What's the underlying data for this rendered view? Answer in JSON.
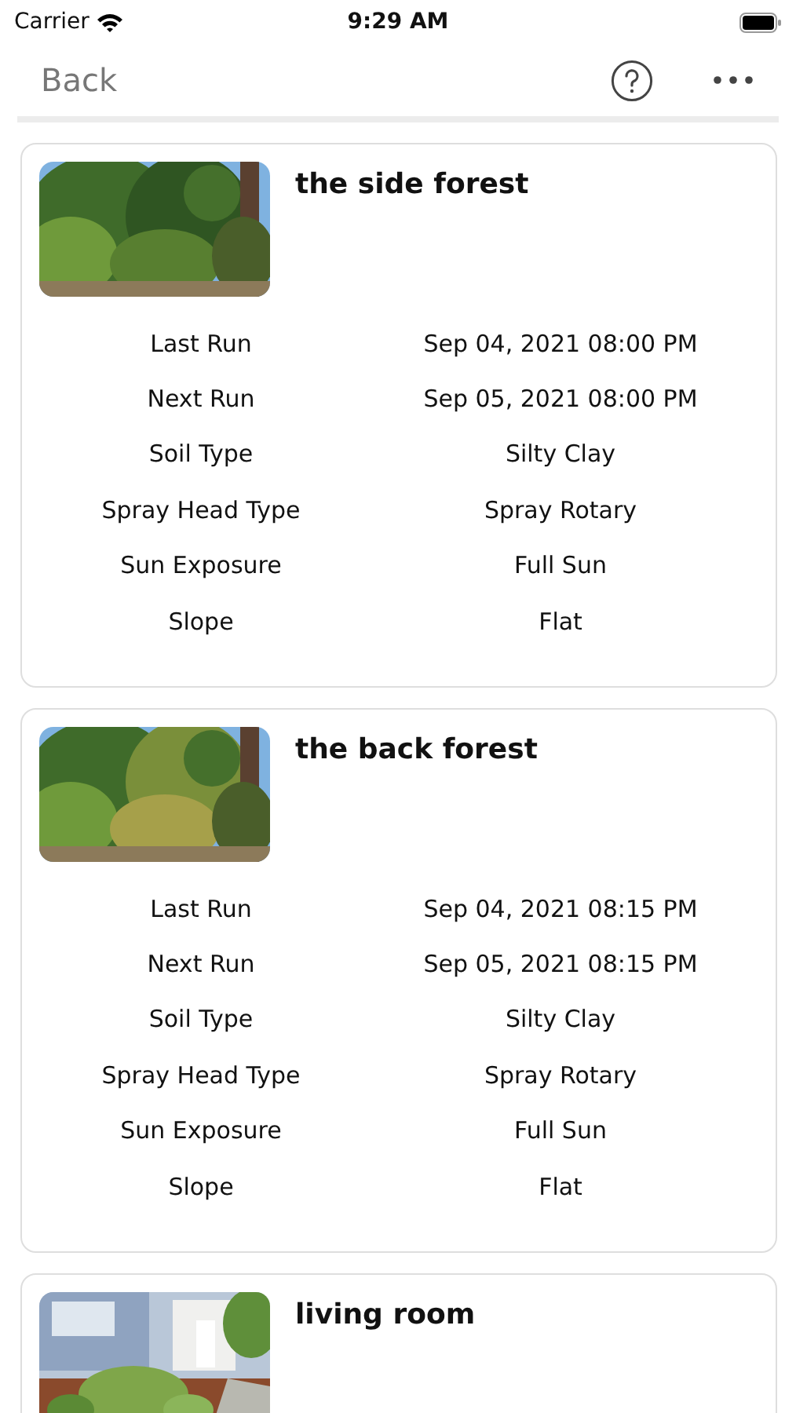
{
  "status_bar": {
    "carrier": "Carrier",
    "time": "9:29 AM"
  },
  "nav": {
    "back": "Back"
  },
  "zones": [
    {
      "title": "the side forest",
      "rows": [
        {
          "label": "Last Run",
          "value": "Sep 04, 2021 08:00 PM"
        },
        {
          "label": "Next Run",
          "value": "Sep 05, 2021 08:00 PM"
        },
        {
          "label": "Soil Type",
          "value": "Silty Clay"
        },
        {
          "label": "Spray Head Type",
          "value": "Spray Rotary"
        },
        {
          "label": "Sun Exposure",
          "value": "Full Sun"
        },
        {
          "label": "Slope",
          "value": "Flat"
        }
      ]
    },
    {
      "title": "the back forest",
      "rows": [
        {
          "label": "Last Run",
          "value": "Sep 04, 2021 08:15 PM"
        },
        {
          "label": "Next Run",
          "value": "Sep 05, 2021 08:15 PM"
        },
        {
          "label": "Soil Type",
          "value": "Silty Clay"
        },
        {
          "label": "Spray Head Type",
          "value": "Spray Rotary"
        },
        {
          "label": "Sun Exposure",
          "value": "Full Sun"
        },
        {
          "label": "Slope",
          "value": "Flat"
        }
      ]
    },
    {
      "title": "living room"
    }
  ]
}
